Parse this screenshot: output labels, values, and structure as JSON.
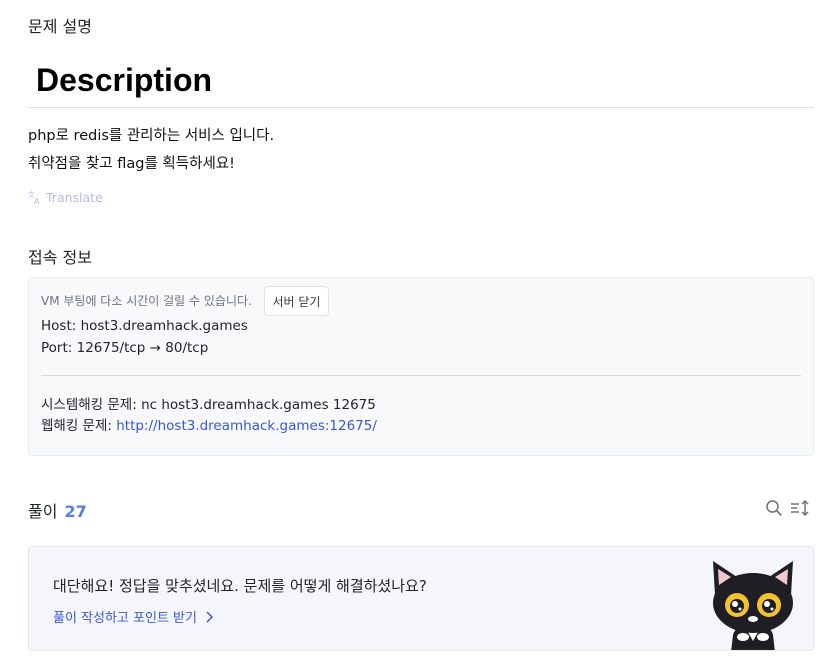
{
  "sections": {
    "description_title": "문제 설명",
    "connection_title": "접속 정보"
  },
  "description": {
    "heading": "Description",
    "lines": [
      "php로 redis를 관리하는 서비스 입니다.",
      "취약점을 찾고 flag를 획득하세요!"
    ],
    "translate_label": "Translate"
  },
  "connection": {
    "vm_note": "VM 부팅에 다소 시간이 걸릴 수 있습니다.",
    "close_button": "서버 닫기",
    "host_line": "Host: host3.dreamhack.games",
    "port_line": "Port:  12675/tcp → 80/tcp",
    "system_line": "시스템해킹 문제: nc host3.dreamhack.games 12675",
    "web_prefix": "웹해킹 문제: ",
    "web_link": "http://host3.dreamhack.games:12675/"
  },
  "solutions": {
    "label": "풀이",
    "count": "27",
    "search_icon": "search-icon",
    "sort_icon": "sort-icon"
  },
  "cta": {
    "title": "대단해요! 정답을 맞추셨네요. 문제를 어떻게 해결하셨나요?",
    "link": "풀이 작성하고 포인트 받기",
    "mascot": "black-cat-mascot"
  },
  "colors": {
    "accent": "#3a56d4",
    "count": "#5b7be0",
    "translate": "#b6bce8",
    "box_bg": "#f8f9fa",
    "cta_bg": "#f4f6fb"
  }
}
